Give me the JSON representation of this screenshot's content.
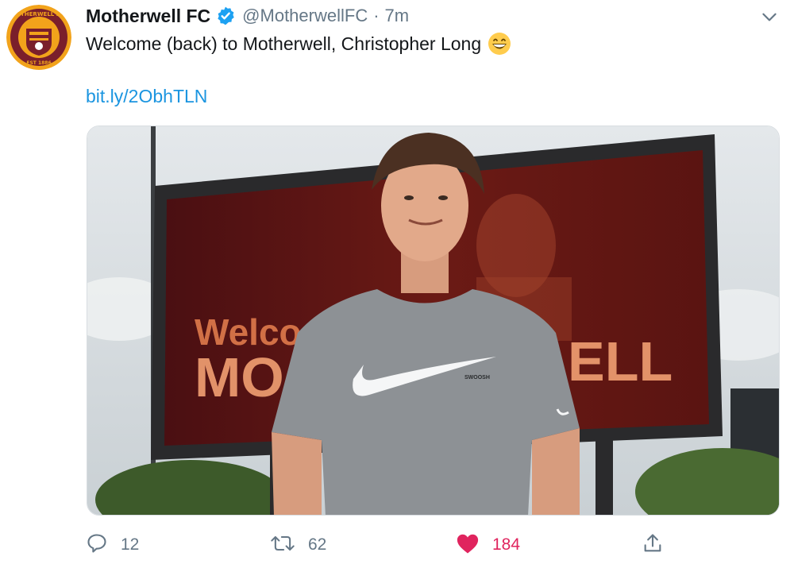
{
  "tweet": {
    "author": {
      "display_name": "Motherwell FC",
      "handle": "@MotherwellFC",
      "time": "7m",
      "separator": "·",
      "verified_icon": "verified-badge-icon",
      "avatar_crest_top": "MOTHERWELL F.C.",
      "avatar_crest_bottom": "EST 1886"
    },
    "text": "Welcome (back) to Motherwell, Christopher Long",
    "emoji": "grinning-face-icon",
    "link": "bit.ly/2ObhTLN",
    "media": {
      "billboard_text_line1": "Welco",
      "billboard_text_line2": "MO",
      "billboard_text_right": "ELL",
      "shirt_text": "SWOOSH"
    },
    "actions": {
      "reply_count": "12",
      "retweet_count": "62",
      "like_count": "184"
    },
    "colors": {
      "link": "#1b95e0",
      "like": "#e0245e",
      "muted": "#657786",
      "verified": "#1da1f2",
      "crest_maroon": "#7a1f2b",
      "crest_amber": "#f2a31b"
    }
  }
}
